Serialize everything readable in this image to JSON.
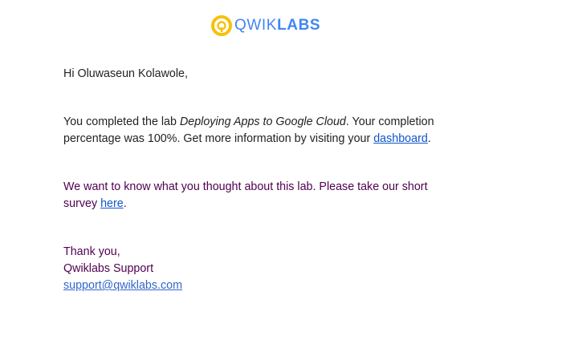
{
  "logo": {
    "text_a": "QWIK",
    "text_b": "LABS",
    "icon": "qwiklabs-logo-icon",
    "colors": {
      "icon": "#F4C20D",
      "text": "#4285F4"
    }
  },
  "email": {
    "greeting": "Hi Oluwaseun Kolawole,",
    "completion": {
      "prefix": "You completed the lab ",
      "lab_name": "Deploying Apps to Google Cloud",
      "middle": ". Your completion percentage was 100%. Get more information by visiting your ",
      "link_label": "dashboard",
      "suffix": "."
    },
    "survey": {
      "prefix": "We want to know what you thought about this lab. Please take our short survey ",
      "link_label": "here",
      "suffix": "."
    },
    "signoff": {
      "thanks": "Thank you,",
      "team": "Qwiklabs Support",
      "email": "support@qwiklabs.com"
    }
  },
  "colors": {
    "body_text": "#222222",
    "quoted_text": "#500050",
    "link": "#1155CC"
  }
}
